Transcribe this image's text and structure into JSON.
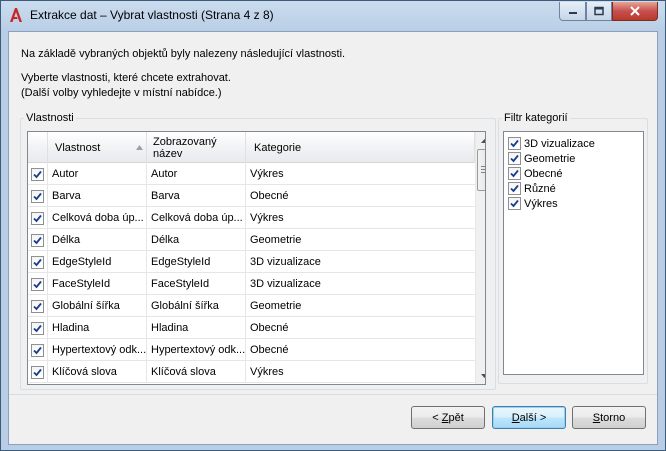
{
  "window": {
    "title": "Extrakce dat – Vybrat vlastnosti (Strana 4 z 8)"
  },
  "intro": {
    "line1": "Na základě vybraných objektů byly nalezeny následující vlastnosti.",
    "line2": "Vyberte vlastnosti, které chcete extrahovat.",
    "line3": "(Další volby vyhledejte v místní nabídce.)"
  },
  "properties": {
    "group_label": "Vlastnosti",
    "columns": {
      "property": "Vlastnost",
      "display_name": "Zobrazovaný název",
      "category": "Kategorie"
    },
    "rows": [
      {
        "property": "Autor",
        "display_name": "Autor",
        "category": "Výkres",
        "checked": true
      },
      {
        "property": "Barva",
        "display_name": "Barva",
        "category": "Obecné",
        "checked": true
      },
      {
        "property": "Celková doba úp...",
        "display_name": "Celková doba úp...",
        "category": "Výkres",
        "checked": true
      },
      {
        "property": "Délka",
        "display_name": "Délka",
        "category": "Geometrie",
        "checked": true
      },
      {
        "property": "EdgeStyleId",
        "display_name": "EdgeStyleId",
        "category": "3D vizualizace",
        "checked": true
      },
      {
        "property": "FaceStyleId",
        "display_name": "FaceStyleId",
        "category": "3D vizualizace",
        "checked": true
      },
      {
        "property": "Globální šířka",
        "display_name": "Globální šířka",
        "category": "Geometrie",
        "checked": true
      },
      {
        "property": "Hladina",
        "display_name": "Hladina",
        "category": "Obecné",
        "checked": true
      },
      {
        "property": "Hypertextový odk...",
        "display_name": "Hypertextový odk...",
        "category": "Obecné",
        "checked": true
      },
      {
        "property": "Klíčová slova",
        "display_name": "Klíčová slova",
        "category": "Výkres",
        "checked": true
      }
    ]
  },
  "category_filter": {
    "group_label": "Filtr kategorií",
    "items": [
      {
        "label": "3D vizualizace",
        "checked": true
      },
      {
        "label": "Geometrie",
        "checked": true
      },
      {
        "label": "Obecné",
        "checked": true
      },
      {
        "label": "Různé",
        "checked": true
      },
      {
        "label": "Výkres",
        "checked": true
      }
    ]
  },
  "buttons": {
    "back": "< Zpět",
    "next": "Další >",
    "cancel": "Storno"
  },
  "colors": {
    "accent": "#c62828",
    "checkmark": "#1a3d8f"
  }
}
